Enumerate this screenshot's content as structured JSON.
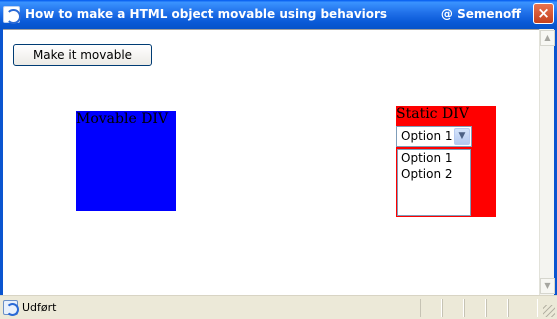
{
  "window": {
    "title": "How to make a HTML object movable using behaviors",
    "title_right": "@ Semenoff",
    "close_glyph": "×"
  },
  "page": {
    "button_label": "Make it movable",
    "movable_div_label": "Movable DIV",
    "static_div_label": "Static DIV",
    "select": {
      "value": "Option 1",
      "arrow_glyph": "▼"
    },
    "listbox": {
      "items": [
        "Option 1",
        "Option 2"
      ]
    }
  },
  "status": {
    "text": "Udført"
  },
  "scrollbar": {
    "up_glyph": "▲",
    "down_glyph": "▼"
  },
  "colors": {
    "movable_div": "#0000ff",
    "static_div": "#ff0000",
    "titlebar": "#0a5ad8"
  }
}
